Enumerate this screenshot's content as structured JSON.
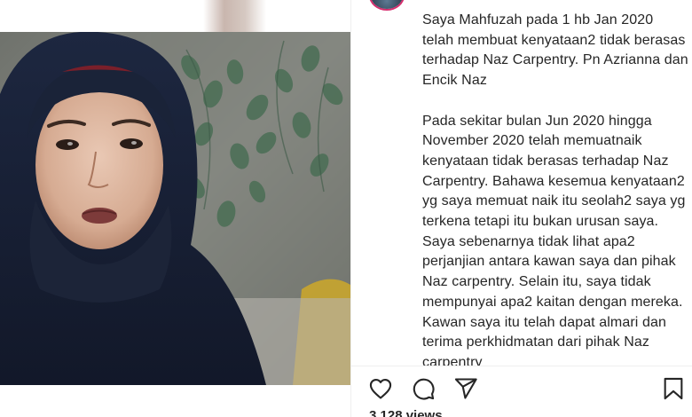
{
  "post": {
    "caption_paragraphs": [
      "Saya Mahfuzah pada 1 hb Jan 2020 telah membuat kenyataan2 tidak berasas terhadap Naz Carpentry. Pn Azrianna dan Encik Naz",
      "Pada sekitar bulan Jun 2020 hingga November 2020 telah memuatnaik kenyataan tidak berasas terhadap Naz Carpentry. Bahawa kesemua kenyataan2 yg saya memuat naik itu seolah2 saya yg terkena tetapi itu bukan urusan saya. Saya sebenarnya tidak lihat apa2 perjanjian antara kawan saya dan pihak Naz carpentry. Selain itu, saya tidak mempunyai apa2 kaitan dengan mereka. Kawan saya itu telah dapat almari dan terima perkhidmatan dari pihak Naz carpentry"
    ],
    "views_text": "3,128 views"
  },
  "actions": {
    "like_icon": "heart-outline",
    "comment_icon": "speech-bubble",
    "share_icon": "paper-plane",
    "save_icon": "bookmark-outline"
  },
  "colors": {
    "text": "#262626",
    "border": "#efefef",
    "story_ring": "#d62d6e",
    "hijab": "#1c2438"
  }
}
